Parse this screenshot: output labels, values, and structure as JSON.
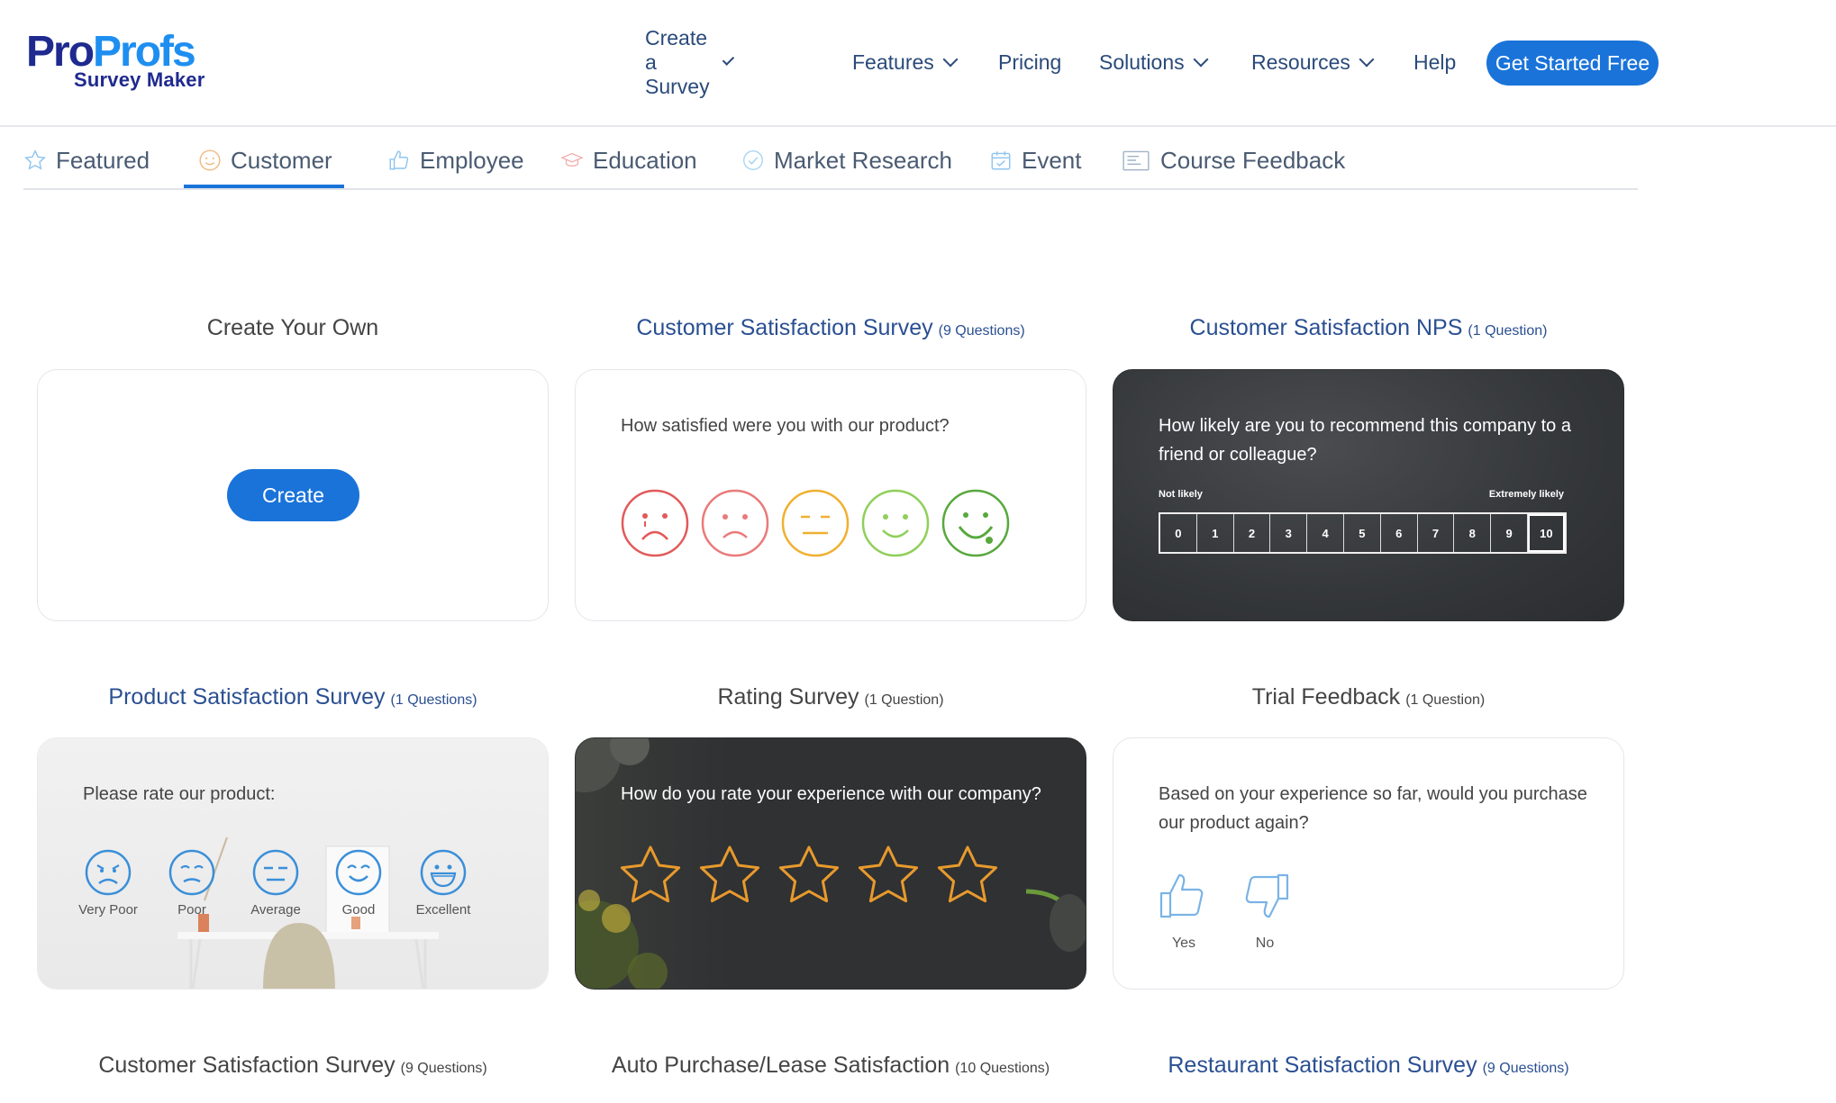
{
  "logo": {
    "pro": "Pro",
    "profs": "Profs",
    "sub": "Survey Maker"
  },
  "nav": {
    "items": [
      {
        "label": "Create a Survey",
        "dropdown": true
      },
      {
        "label": "Features",
        "dropdown": true
      },
      {
        "label": "Pricing",
        "dropdown": false
      },
      {
        "label": "Solutions",
        "dropdown": true
      },
      {
        "label": "Resources",
        "dropdown": true
      },
      {
        "label": "Help",
        "dropdown": false
      }
    ],
    "cta": "Get Started Free"
  },
  "tabs": {
    "items": [
      {
        "label": "Featured",
        "icon": "star-icon"
      },
      {
        "label": "Customer",
        "icon": "smiley-icon"
      },
      {
        "label": "Employee",
        "icon": "thumbs-up-icon"
      },
      {
        "label": "Education",
        "icon": "graduation-cap-icon"
      },
      {
        "label": "Market Research",
        "icon": "check-badge-icon"
      },
      {
        "label": "Event",
        "icon": "calendar-icon"
      },
      {
        "label": "Course Feedback",
        "icon": "document-icon"
      }
    ],
    "active": "Customer"
  },
  "templates": {
    "create_own": {
      "title": "Create Your Own",
      "button": "Create"
    },
    "csat": {
      "title": "Customer Satisfaction Survey",
      "count": "(9 Questions)",
      "question": "How satisfied were you with our product?"
    },
    "nps": {
      "title": "Customer Satisfaction NPS",
      "count": "(1 Question)",
      "question_l1": "How likely are you to recommend this company to a",
      "question_l2": "friend or colleague?",
      "low": "Not likely",
      "high": "Extremely likely",
      "scale": [
        "0",
        "1",
        "2",
        "3",
        "4",
        "5",
        "6",
        "7",
        "8",
        "9",
        "10"
      ],
      "selected": "10"
    },
    "product": {
      "title": "Product Satisfaction Survey",
      "count": "(1 Questions)",
      "question": "Please rate our product:",
      "options": [
        "Very Poor",
        "Poor",
        "Average",
        "Good",
        "Excellent"
      ]
    },
    "rating": {
      "title": "Rating Survey",
      "count": "(1 Question)",
      "question": "How do you rate your experience with our company?",
      "stars": 5
    },
    "trial": {
      "title": "Trial Feedback",
      "count": "(1 Question)",
      "question_l1": "Based on your experience so far, would you purchase",
      "question_l2": "our product again?",
      "yes": "Yes",
      "no": "No"
    },
    "row3": [
      {
        "title": "Customer Satisfaction Survey",
        "count": "(9 Questions)"
      },
      {
        "title": "Auto Purchase/Lease Satisfaction",
        "count": "(10 Questions)"
      },
      {
        "title": "Restaurant Satisfaction Survey",
        "count": "(9 Questions)"
      }
    ]
  },
  "colors": {
    "primary": "#1a73d9",
    "title_blue": "#2a4f92",
    "nav_text": "#2a4a7a",
    "dark_card": "#2d2f31",
    "star": "#e89a2c"
  }
}
